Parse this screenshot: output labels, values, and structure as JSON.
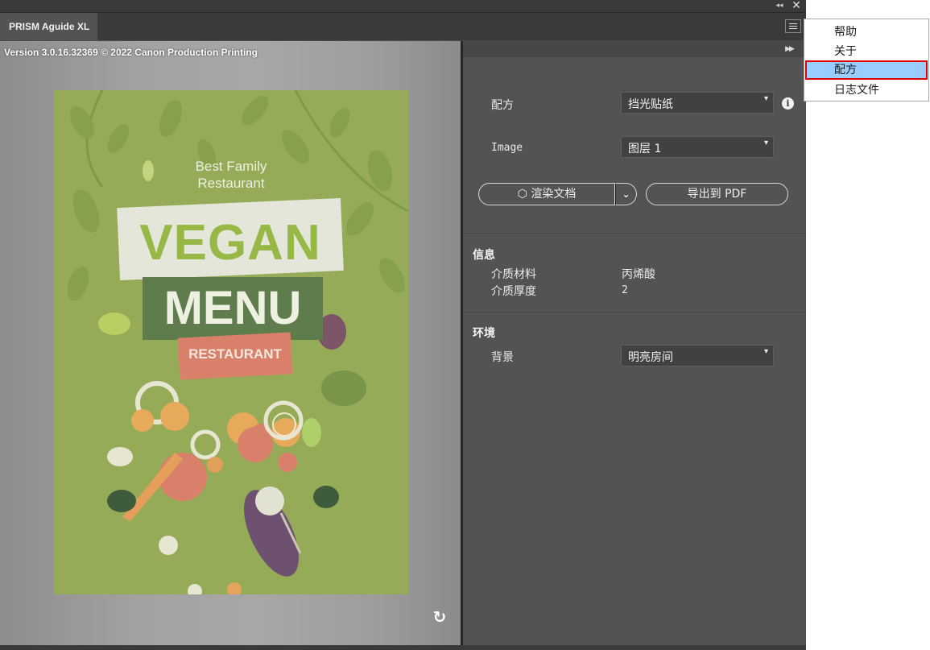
{
  "window": {
    "collapse_icon": "double-chevron-left-icon",
    "close_icon": "close-icon"
  },
  "tabs": [
    {
      "label": "PRISM Aguide XL"
    }
  ],
  "preview": {
    "version_text": "Version 3.0.16.32369 © 2022 Canon Production Printing",
    "poster": {
      "subtitle_line1": "Best Family",
      "subtitle_line2": "Restaurant",
      "title": "VEGAN",
      "menu": "MENU",
      "restaurant": "RESTAURANT"
    },
    "refresh_icon": "refresh-icon"
  },
  "panel": {
    "recipe_label": "配方",
    "recipe_value": "挡光贴纸",
    "image_label": "Image",
    "image_value": "图层 1",
    "render_button": "渲染文档",
    "render_icon": "cube-icon",
    "export_button": "导出到 PDF",
    "info_section": {
      "title": "信息",
      "rows": [
        {
          "key": "介质材料",
          "value": "丙烯酸"
        },
        {
          "key": "介质厚度",
          "value": "2"
        }
      ]
    },
    "env_section": {
      "title": "环境",
      "background_label": "背景",
      "background_value": "明亮房间"
    }
  },
  "context_menu": {
    "items": [
      {
        "label": "帮助",
        "selected": false
      },
      {
        "label": "关于",
        "selected": false
      },
      {
        "label": "配方",
        "selected": true
      },
      {
        "label": "日志文件",
        "selected": false
      }
    ]
  },
  "colors": {
    "panel_bg": "#535353",
    "poster_green": "#95ab57",
    "selection_highlight": "#99ccff",
    "selection_border": "#e00000"
  }
}
